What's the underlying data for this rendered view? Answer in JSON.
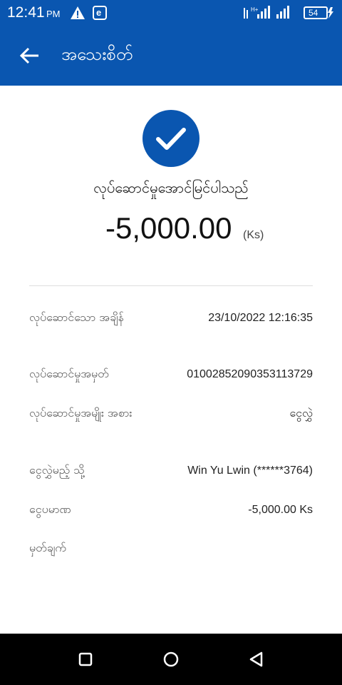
{
  "status_bar": {
    "time": "12:41",
    "ampm": "PM",
    "app_icon_letter": "e",
    "battery": "54"
  },
  "app_bar": {
    "title": "အသေးစိတ်"
  },
  "result": {
    "title": "လုပ်ဆောင်မှုအောင်မြင်ပါသည်",
    "amount": "-5,000.00",
    "unit": "(Ks)"
  },
  "details": [
    {
      "label": "လုပ်ဆောင်သော အချိန်",
      "value": "23/10/2022 12:16:35"
    },
    {
      "label": "လုပ်ဆောင်မှုအမှတ်",
      "value": "01002852090353113729"
    },
    {
      "label": "လုပ်ဆောင်မှုအမျိုး အစား",
      "value": "ငွေလွှဲ"
    },
    {
      "label": "ငွေလွှဲမည့် သို့",
      "value": "Win Yu Lwin (******3764)"
    },
    {
      "label": "ငွေပမာဏ",
      "value": "-5,000.00 Ks"
    },
    {
      "label": "မှတ်ချက်",
      "value": ""
    }
  ],
  "colors": {
    "primary": "#0a56b0",
    "nav_bar": "#000000"
  },
  "icons": {
    "back": "arrow-left-icon",
    "success": "check-circle-icon",
    "nav_recent": "square-icon",
    "nav_home": "circle-icon",
    "nav_back": "triangle-back-icon"
  }
}
